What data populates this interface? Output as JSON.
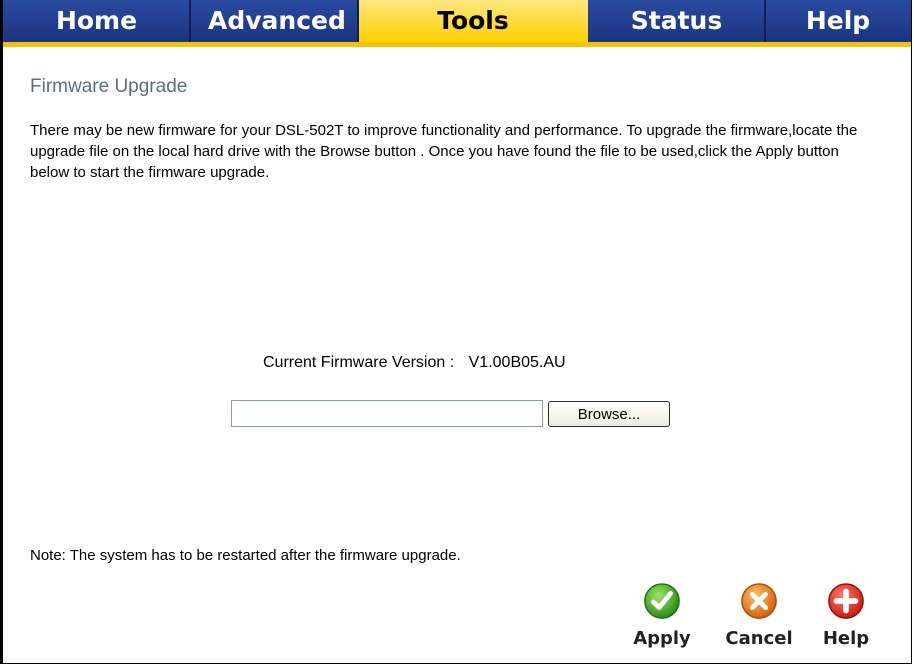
{
  "nav": {
    "tabs": [
      {
        "label": "Home"
      },
      {
        "label": "Advanced"
      },
      {
        "label": "Tools"
      },
      {
        "label": "Status"
      },
      {
        "label": "Help"
      }
    ],
    "active": "Tools"
  },
  "page": {
    "title": "Firmware Upgrade",
    "description": "There may be new firmware for your DSL-502T to improve functionality and performance. To upgrade the firmware,locate the upgrade file on the local hard drive with the Browse button . Once you have found the file to be used,click the Apply button below to start the firmware upgrade.",
    "firmware_label": "Current Firmware Version :",
    "firmware_value": "V1.00B05.AU",
    "file_value": "",
    "browse_label": "Browse...",
    "note": "Note: The system has to be restarted after the firmware upgrade."
  },
  "actions": {
    "apply": {
      "label": "Apply",
      "icon": "check-icon",
      "color": "#3aa51f"
    },
    "cancel": {
      "label": "Cancel",
      "icon": "x-icon",
      "color": "#e07a17"
    },
    "help": {
      "label": "Help",
      "icon": "plus-icon",
      "color": "#d42a22"
    }
  },
  "colors": {
    "nav_bg": "#1f3a8f",
    "nav_active": "#ffd200",
    "title": "#5a6d86"
  }
}
